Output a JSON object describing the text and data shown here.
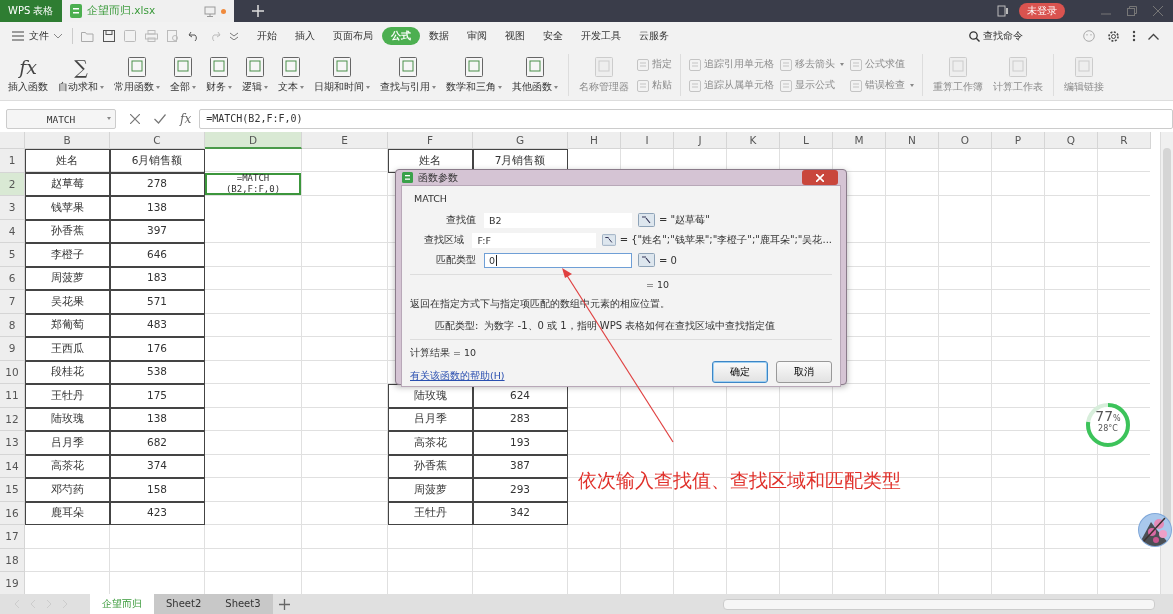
{
  "title_bar": {
    "app_label": "WPS 表格",
    "file_tab": {
      "label": "企望而归.xlsx",
      "modified": true
    },
    "login": "未登录"
  },
  "menu_bar": {
    "file_label": "文件",
    "tabs": [
      {
        "label": "开始",
        "selected": false
      },
      {
        "label": "插入",
        "selected": false
      },
      {
        "label": "页面布局",
        "selected": false
      },
      {
        "label": "公式",
        "selected": true
      },
      {
        "label": "数据",
        "selected": false
      },
      {
        "label": "审阅",
        "selected": false
      },
      {
        "label": "视图",
        "selected": false
      },
      {
        "label": "安全",
        "selected": false
      },
      {
        "label": "开发工具",
        "selected": false
      },
      {
        "label": "云服务",
        "selected": false
      }
    ],
    "search_label": "查找命令"
  },
  "ribbon": [
    {
      "kind": "large",
      "glyph": "fx",
      "label": "插入函数",
      "dropdown": false,
      "disabled": false
    },
    {
      "kind": "large",
      "glyph": "∑",
      "label": "自动求和",
      "dropdown": true,
      "disabled": false
    },
    {
      "kind": "large",
      "label": "常用函数",
      "dropdown": true,
      "disabled": false
    },
    {
      "kind": "large",
      "label": "全部",
      "dropdown": true,
      "disabled": false
    },
    {
      "kind": "large",
      "label": "财务",
      "dropdown": true,
      "disabled": false
    },
    {
      "kind": "large",
      "label": "逻辑",
      "dropdown": true,
      "disabled": false
    },
    {
      "kind": "large",
      "label": "文本",
      "dropdown": true,
      "disabled": false
    },
    {
      "kind": "large",
      "label": "日期和时间",
      "dropdown": true,
      "disabled": false
    },
    {
      "kind": "large",
      "label": "查找与引用",
      "dropdown": true,
      "disabled": false
    },
    {
      "kind": "large",
      "label": "数学和三角",
      "dropdown": true,
      "disabled": false
    },
    {
      "kind": "large",
      "label": "其他函数",
      "dropdown": true,
      "disabled": false
    },
    {
      "kind": "separator"
    },
    {
      "kind": "large",
      "label": "名称管理器",
      "dropdown": false,
      "disabled": true
    },
    {
      "kind": "stack",
      "items": [
        {
          "label": "指定",
          "dropdown": false,
          "disabled": true
        },
        {
          "label": "粘贴",
          "dropdown": false,
          "disabled": true
        }
      ]
    },
    {
      "kind": "separator"
    },
    {
      "kind": "stack",
      "items": [
        {
          "label": "追踪引用单元格",
          "dropdown": false,
          "disabled": true
        },
        {
          "label": "追踪从属单元格",
          "dropdown": false,
          "disabled": true
        }
      ]
    },
    {
      "kind": "stack",
      "items": [
        {
          "label": "移去箭头",
          "dropdown": true,
          "disabled": true
        },
        {
          "label": "显示公式",
          "dropdown": false,
          "disabled": true
        }
      ]
    },
    {
      "kind": "stack",
      "items": [
        {
          "label": "公式求值",
          "dropdown": false,
          "disabled": true
        },
        {
          "label": "错误检查",
          "dropdown": true,
          "disabled": true
        }
      ]
    },
    {
      "kind": "separator"
    },
    {
      "kind": "large",
      "label": "重算工作簿",
      "dropdown": false,
      "disabled": true
    },
    {
      "kind": "large",
      "label": "计算工作表",
      "dropdown": false,
      "disabled": true
    },
    {
      "kind": "separator"
    },
    {
      "kind": "large",
      "label": "编辑链接",
      "dropdown": false,
      "disabled": true
    }
  ],
  "formula_bar": {
    "name_box": "MATCH",
    "fx_label": "fx",
    "formula": "=MATCH(B2,F:F,0)"
  },
  "sheet": {
    "columns": [
      "B",
      "C",
      "D",
      "E",
      "F",
      "G",
      "H",
      "I",
      "J",
      "K",
      "L",
      "M",
      "N",
      "O",
      "P",
      "Q",
      "R"
    ],
    "rows": [
      {
        "label": "1",
        "cells": {
          "B": {
            "text": "姓名"
          },
          "C": {
            "text": "6月销售额"
          },
          "F": {
            "text": "姓名"
          },
          "G": {
            "text": "7月销售额"
          }
        }
      },
      {
        "label": "2",
        "cells": {
          "B": {
            "text": "赵草莓"
          },
          "C": {
            "text": "278"
          },
          "D": {
            "text": "=MATCH\n(B2,F:F,0)",
            "selected": true
          }
        }
      },
      {
        "label": "3",
        "cells": {
          "B": {
            "text": "钱苹果"
          },
          "C": {
            "text": "138"
          }
        }
      },
      {
        "label": "4",
        "cells": {
          "B": {
            "text": "孙香蕉"
          },
          "C": {
            "text": "397"
          }
        }
      },
      {
        "label": "5",
        "cells": {
          "B": {
            "text": "李橙子"
          },
          "C": {
            "text": "646"
          }
        }
      },
      {
        "label": "6",
        "cells": {
          "B": {
            "text": "周菠萝"
          },
          "C": {
            "text": "183"
          }
        }
      },
      {
        "label": "7",
        "cells": {
          "B": {
            "text": "吴花果"
          },
          "C": {
            "text": "571"
          }
        }
      },
      {
        "label": "8",
        "cells": {
          "B": {
            "text": "郑葡萄"
          },
          "C": {
            "text": "483"
          }
        }
      },
      {
        "label": "9",
        "cells": {
          "B": {
            "text": "王西瓜"
          },
          "C": {
            "text": "176"
          }
        }
      },
      {
        "label": "10",
        "cells": {
          "B": {
            "text": "段桂花"
          },
          "C": {
            "text": "538"
          }
        }
      },
      {
        "label": "11",
        "cells": {
          "B": {
            "text": "王牡丹"
          },
          "C": {
            "text": "175"
          },
          "F": {
            "text": "陆玫瑰"
          },
          "G": {
            "text": "624"
          }
        }
      },
      {
        "label": "12",
        "cells": {
          "B": {
            "text": "陆玫瑰"
          },
          "C": {
            "text": "138"
          },
          "F": {
            "text": "吕月季"
          },
          "G": {
            "text": "283"
          }
        }
      },
      {
        "label": "13",
        "cells": {
          "B": {
            "text": "吕月季"
          },
          "C": {
            "text": "682"
          },
          "F": {
            "text": "高茶花"
          },
          "G": {
            "text": "193"
          }
        }
      },
      {
        "label": "14",
        "cells": {
          "B": {
            "text": "高茶花"
          },
          "C": {
            "text": "374"
          },
          "F": {
            "text": "孙香蕉"
          },
          "G": {
            "text": "387"
          }
        }
      },
      {
        "label": "15",
        "cells": {
          "B": {
            "text": "邓芍药"
          },
          "C": {
            "text": "158"
          },
          "F": {
            "text": "周菠萝"
          },
          "G": {
            "text": "293"
          }
        }
      },
      {
        "label": "16",
        "cells": {
          "B": {
            "text": "鹿耳朵"
          },
          "C": {
            "text": "423"
          },
          "F": {
            "text": "王牡丹"
          },
          "G": {
            "text": "342"
          }
        }
      },
      {
        "label": "17"
      },
      {
        "label": "18"
      },
      {
        "label": "19"
      }
    ]
  },
  "dialog": {
    "title": "函数参数",
    "function": "MATCH",
    "args": [
      {
        "label": "查找值",
        "value": "B2",
        "result": "= \"赵草莓\"",
        "focused": false
      },
      {
        "label": "查找区域",
        "value": "F:F",
        "result": "= {\"姓名\";\"钱苹果\";\"李橙子\";\"鹿耳朵\";\"吴花...",
        "focused": false
      },
      {
        "label": "匹配类型",
        "value": "0",
        "result": "= 0",
        "focused": true
      }
    ],
    "overall": "= 10",
    "description": "返回在指定方式下与指定项匹配的数组中元素的相应位置。",
    "arg_help_label": "匹配类型:",
    "arg_help": "为数字 -1、0 或 1，指明 WPS 表格如何在查找区域中查找指定值",
    "result_label": "计算结果 = 10",
    "help_link": "有关该函数的帮助(H)",
    "buttons": [
      {
        "label": "确定",
        "default": true
      },
      {
        "label": "取消",
        "default": false
      }
    ]
  },
  "annotation": {
    "text": "依次输入查找值、查找区域和匹配类型"
  },
  "memory_widget": {
    "percent": "77",
    "unit": "%",
    "temperature": "28°C",
    "level": 0.77
  },
  "sheet_tabs": [
    {
      "label": "企望而归",
      "selected": true
    },
    {
      "label": "Sheet2",
      "selected": false
    },
    {
      "label": "Sheet3",
      "selected": false
    }
  ]
}
